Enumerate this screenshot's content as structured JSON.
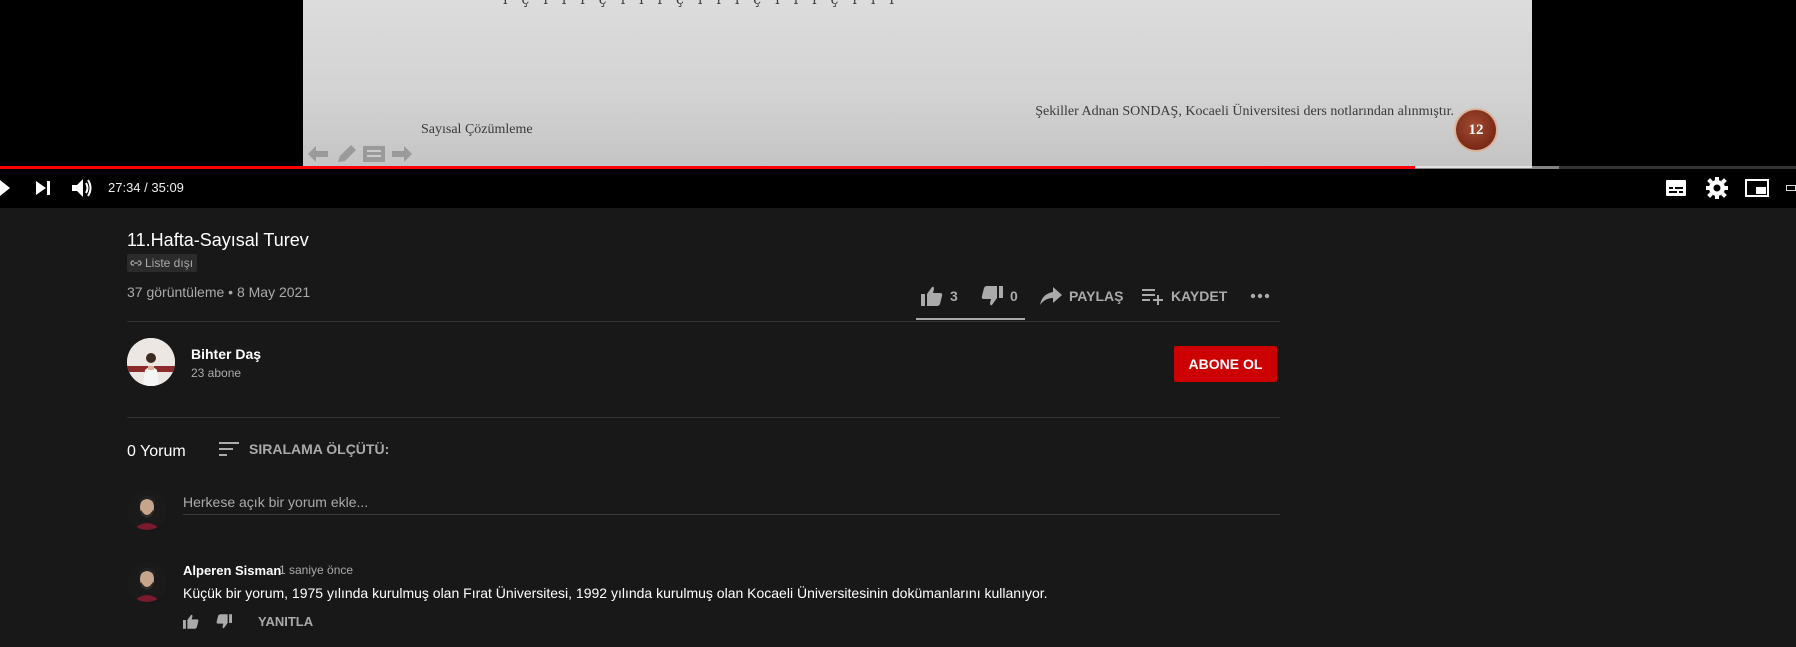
{
  "video": {
    "slide_glyphs": "ıçıııçıııçıııçıııçııı",
    "slide_credit": "Şekiller Adnan SONDAŞ, Kocaeli Üniversitesi ders notlarından alınmıştır.",
    "slide_title": "Sayısal Çözümleme",
    "slide_number": "12",
    "progress_fraction": 0.788,
    "buffer_fraction": 0.868,
    "time_display": "27:34 / 35:09"
  },
  "info": {
    "title": "11.Hafta-Sayısal Turev",
    "unlisted_label": "Liste dışı",
    "meta": "37 görüntüleme • 8 May 2021",
    "like_count": "3",
    "dislike_count": "0",
    "share_label": "PAYLAŞ",
    "save_label": "KAYDET"
  },
  "channel": {
    "name": "Bihter Daş",
    "subscribers": "23 abone",
    "subscribe_label": "ABONE OL"
  },
  "comments": {
    "count_label": "0 Yorum",
    "sort_label": "SIRALAMA ÖLÇÜTÜ:",
    "input_placeholder": "Herkese açık bir yorum ekle...",
    "items": [
      {
        "author": "Alperen Sisman",
        "time": "1 saniye önce",
        "text": "Küçük bir yorum, 1975 yılında kurulmuş olan Fırat Üniversitesi, 1992 yılında kurulmuş olan Kocaeli Üniversitesinin dokümanlarını kullanıyor.",
        "reply_label": "YANITLA"
      }
    ]
  },
  "colors": {
    "accent_red": "#ff0000",
    "subscribe_red": "#cc0000",
    "background": "#181818",
    "secondary_text": "#aaaaaa"
  },
  "icons": [
    "play-icon",
    "next-icon",
    "volume-icon",
    "subtitles-icon",
    "settings-icon",
    "miniplayer-icon",
    "theater-icon",
    "link-icon",
    "like-icon",
    "dislike-icon",
    "share-icon",
    "save-playlist-icon",
    "more-icon",
    "sort-icon"
  ]
}
